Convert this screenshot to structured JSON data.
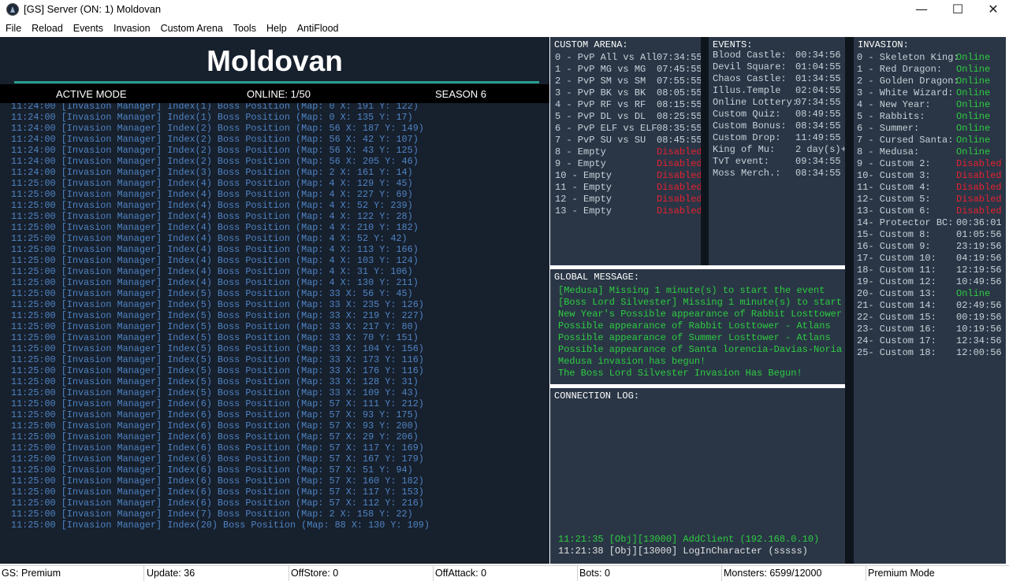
{
  "window": {
    "title": "[GS] Server (ON: 1) Moldovan",
    "controls": {
      "minimize": "—",
      "maximize": "☐",
      "close": "✕"
    }
  },
  "menu": [
    "File",
    "Reload",
    "Events",
    "Invasion",
    "Custom Arena",
    "Tools",
    "Help",
    "AntiFlood"
  ],
  "header": {
    "server_name": "Moldovan",
    "mode": "ACTIVE MODE",
    "online": "ONLINE: 1/50",
    "season": "SEASON 6"
  },
  "log": [
    "11:24:00 [Invasion Manager] Index(1) Boss Position (Map: 0 X: 191 Y: 122)",
    "11:24:00 [Invasion Manager] Index(1) Boss Position (Map: 0 X: 135 Y: 17)",
    "11:24:00 [Invasion Manager] Index(2) Boss Position (Map: 56 X: 187 Y: 149)",
    "11:24:00 [Invasion Manager] Index(2) Boss Position (Map: 56 X: 42 Y: 107)",
    "11:24:00 [Invasion Manager] Index(2) Boss Position (Map: 56 X: 43 Y: 125)",
    "11:24:00 [Invasion Manager] Index(2) Boss Position (Map: 56 X: 205 Y: 46)",
    "11:24:00 [Invasion Manager] Index(3) Boss Position (Map: 2 X: 161 Y: 14)",
    "11:25:00 [Invasion Manager] Index(4) Boss Position (Map: 4 X: 129 Y: 45)",
    "11:25:00 [Invasion Manager] Index(4) Boss Position (Map: 4 X: 227 Y: 69)",
    "11:25:00 [Invasion Manager] Index(4) Boss Position (Map: 4 X: 52 Y: 239)",
    "11:25:00 [Invasion Manager] Index(4) Boss Position (Map: 4 X: 122 Y: 28)",
    "11:25:00 [Invasion Manager] Index(4) Boss Position (Map: 4 X: 210 Y: 182)",
    "11:25:00 [Invasion Manager] Index(4) Boss Position (Map: 4 X: 52 Y: 42)",
    "11:25:00 [Invasion Manager] Index(4) Boss Position (Map: 4 X: 113 Y: 166)",
    "11:25:00 [Invasion Manager] Index(4) Boss Position (Map: 4 X: 103 Y: 124)",
    "11:25:00 [Invasion Manager] Index(4) Boss Position (Map: 4 X: 31 Y: 106)",
    "11:25:00 [Invasion Manager] Index(4) Boss Position (Map: 4 X: 130 Y: 211)",
    "11:25:00 [Invasion Manager] Index(5) Boss Position (Map: 33 X: 56 Y: 45)",
    "11:25:00 [Invasion Manager] Index(5) Boss Position (Map: 33 X: 235 Y: 126)",
    "11:25:00 [Invasion Manager] Index(5) Boss Position (Map: 33 X: 219 Y: 227)",
    "11:25:00 [Invasion Manager] Index(5) Boss Position (Map: 33 X: 217 Y: 80)",
    "11:25:00 [Invasion Manager] Index(5) Boss Position (Map: 33 X: 70 Y: 151)",
    "11:25:00 [Invasion Manager] Index(5) Boss Position (Map: 33 X: 104 Y: 156)",
    "11:25:00 [Invasion Manager] Index(5) Boss Position (Map: 33 X: 173 Y: 116)",
    "11:25:00 [Invasion Manager] Index(5) Boss Position (Map: 33 X: 176 Y: 116)",
    "11:25:00 [Invasion Manager] Index(5) Boss Position (Map: 33 X: 128 Y: 31)",
    "11:25:00 [Invasion Manager] Index(5) Boss Position (Map: 33 X: 109 Y: 43)",
    "11:25:00 [Invasion Manager] Index(6) Boss Position (Map: 57 X: 111 Y: 212)",
    "11:25:00 [Invasion Manager] Index(6) Boss Position (Map: 57 X: 93 Y: 175)",
    "11:25:00 [Invasion Manager] Index(6) Boss Position (Map: 57 X: 93 Y: 200)",
    "11:25:00 [Invasion Manager] Index(6) Boss Position (Map: 57 X: 29 Y: 206)",
    "11:25:00 [Invasion Manager] Index(6) Boss Position (Map: 57 X: 117 Y: 169)",
    "11:25:00 [Invasion Manager] Index(6) Boss Position (Map: 57 X: 167 Y: 179)",
    "11:25:00 [Invasion Manager] Index(6) Boss Position (Map: 57 X: 51 Y: 94)",
    "11:25:00 [Invasion Manager] Index(6) Boss Position (Map: 57 X: 160 Y: 182)",
    "11:25:00 [Invasion Manager] Index(6) Boss Position (Map: 57 X: 117 Y: 153)",
    "11:25:00 [Invasion Manager] Index(6) Boss Position (Map: 57 X: 112 Y: 216)",
    "11:25:00 [Invasion Manager] Index(7) Boss Position (Map: 2 X: 158 Y: 22)",
    "11:25:00 [Invasion Manager] Index(20) Boss Position (Map: 88 X: 130 Y: 109)"
  ],
  "custom_arena": {
    "title": "CUSTOM ARENA:",
    "rows": [
      {
        "name": "0 - PvP All vs All",
        "status": "07:34:55",
        "kind": "time"
      },
      {
        "name": "1 - PvP MG vs MG",
        "status": "07:45:55",
        "kind": "time"
      },
      {
        "name": "2 - PvP SM vs SM",
        "status": "07:55:55",
        "kind": "time"
      },
      {
        "name": "3 - PvP BK vs BK",
        "status": "08:05:55",
        "kind": "time"
      },
      {
        "name": "4 - PvP RF vs RF",
        "status": "08:15:55",
        "kind": "time"
      },
      {
        "name": "5 - PvP DL vs DL",
        "status": "08:25:55",
        "kind": "time"
      },
      {
        "name": "6 - PvP ELF vs ELF",
        "status": "08:35:55",
        "kind": "time"
      },
      {
        "name": "7 - PvP SU vs SU",
        "status": "08:45:55",
        "kind": "time"
      },
      {
        "name": "8 - Empty",
        "status": "Disabled",
        "kind": "disabled"
      },
      {
        "name": "9 - Empty",
        "status": "Disabled",
        "kind": "disabled"
      },
      {
        "name": "10 - Empty",
        "status": "Disabled",
        "kind": "disabled"
      },
      {
        "name": "11 - Empty",
        "status": "Disabled",
        "kind": "disabled"
      },
      {
        "name": "12 - Empty",
        "status": "Disabled",
        "kind": "disabled"
      },
      {
        "name": "13 - Empty",
        "status": "Disabled",
        "kind": "disabled"
      }
    ]
  },
  "events": {
    "title": "EVENTS:",
    "rows": [
      {
        "name": "Blood Castle:",
        "status": "00:34:56"
      },
      {
        "name": "Devil Square:",
        "status": "01:04:55"
      },
      {
        "name": "Chaos Castle:",
        "status": "01:34:55"
      },
      {
        "name": "Illus.Temple",
        "status": "02:04:55"
      },
      {
        "name": "Online Lottery:",
        "status": "07:34:55"
      },
      {
        "name": "Custom Quiz:",
        "status": "08:49:55"
      },
      {
        "name": "Custom Bonus:",
        "status": "08:34:55"
      },
      {
        "name": "Custom Drop:",
        "status": "11:49:55"
      },
      {
        "name": "King of Mu:",
        "status": "2 day(s)+"
      },
      {
        "name": "TvT event:",
        "status": "09:34:55"
      },
      {
        "name": "Moss Merch.:",
        "status": "08:34:55"
      }
    ]
  },
  "invasion": {
    "title": "INVASION:",
    "rows": [
      {
        "name": "0 - Skeleton King:",
        "status": "Online",
        "kind": "online"
      },
      {
        "name": "1 - Red Dragon:",
        "status": "Online",
        "kind": "online"
      },
      {
        "name": "2 - Golden Dragon:",
        "status": "Online",
        "kind": "online"
      },
      {
        "name": "3 - White Wizard:",
        "status": "Online",
        "kind": "online"
      },
      {
        "name": "4 - New Year:",
        "status": "Online",
        "kind": "online"
      },
      {
        "name": "5 - Rabbits:",
        "status": "Online",
        "kind": "online"
      },
      {
        "name": "6 - Summer:",
        "status": "Online",
        "kind": "online"
      },
      {
        "name": "7 - Cursed Santa:",
        "status": "Online",
        "kind": "online"
      },
      {
        "name": "8 - Medusa:",
        "status": "Online",
        "kind": "online"
      },
      {
        "name": "9 - Custom 2:",
        "status": "Disabled",
        "kind": "disabled"
      },
      {
        "name": "10- Custom 3:",
        "status": "Disabled",
        "kind": "disabled"
      },
      {
        "name": "11- Custom 4:",
        "status": "Disabled",
        "kind": "disabled"
      },
      {
        "name": "12- Custom 5:",
        "status": "Disabled",
        "kind": "disabled"
      },
      {
        "name": "13- Custom 6:",
        "status": "Disabled",
        "kind": "disabled"
      },
      {
        "name": "14- Protector BC:",
        "status": "00:36:01",
        "kind": "time"
      },
      {
        "name": "15- Custom 8:",
        "status": "01:05:56",
        "kind": "time"
      },
      {
        "name": "16- Custom 9:",
        "status": "23:19:56",
        "kind": "time"
      },
      {
        "name": "17- Custom 10:",
        "status": "04:19:56",
        "kind": "time"
      },
      {
        "name": "18- Custom 11:",
        "status": "12:19:56",
        "kind": "time"
      },
      {
        "name": "19- Custom 12:",
        "status": "10:49:56",
        "kind": "time"
      },
      {
        "name": "20- Custom 13:",
        "status": "Online",
        "kind": "online"
      },
      {
        "name": "21- Custom 14:",
        "status": "02:49:56",
        "kind": "time"
      },
      {
        "name": "22- Custom 15:",
        "status": "00:19:56",
        "kind": "time"
      },
      {
        "name": "23- Custom 16:",
        "status": "10:19:56",
        "kind": "time"
      },
      {
        "name": "24- Custom 17:",
        "status": "12:34:56",
        "kind": "time"
      },
      {
        "name": "25- Custom 18:",
        "status": "12:00:56",
        "kind": "time"
      }
    ]
  },
  "global_message": {
    "title": "GLOBAL MESSAGE:",
    "lines": [
      "[Medusa] Missing 1 minute(s) to start the event",
      "[Boss Lord Silvester] Missing 1 minute(s) to start",
      "New Year's Possible appearance of Rabbit Losttower",
      "Possible appearance of Rabbit Losttower - Atlans",
      "Possible appearance of Summer Losttower - Atlans",
      "Possible appearance of Santa lorencia-Davias-Noria",
      "Medusa invasion has begun!",
      "The Boss Lord Silvester Invasion Has Begun!"
    ]
  },
  "connection_log": {
    "title": "CONNECTION LOG:",
    "lines": [
      {
        "text": "11:21:35 [Obj][13000] AddClient (192.168.0.10)",
        "color": "#2ecc40"
      },
      {
        "text": "11:21:38 [Obj][13000] LogInCharacter (sssss)",
        "color": "#e0e0e0"
      }
    ]
  },
  "statusbar": [
    "GS: Premium",
    "Update: 36",
    "OffStore: 0",
    "OffAttack: 0",
    "Bots: 0",
    "Monsters: 6599/12000",
    "Premium Mode"
  ],
  "colors": {
    "online": "#2ecc40",
    "disabled": "#e8212f",
    "log_text": "#4f84c4",
    "panel_bg": "#2a3646",
    "log_bg": "#17202d"
  }
}
